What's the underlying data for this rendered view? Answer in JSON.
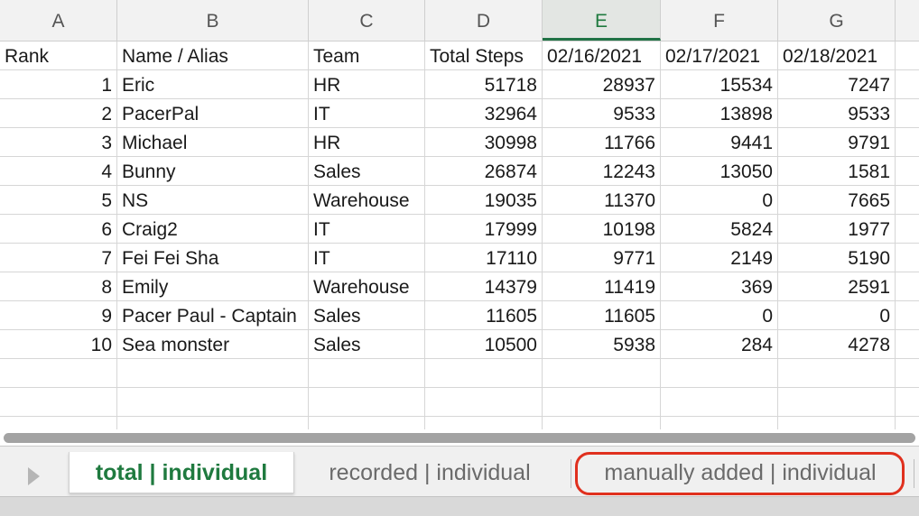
{
  "columns": [
    {
      "letter": "A",
      "selected": false
    },
    {
      "letter": "B",
      "selected": false
    },
    {
      "letter": "C",
      "selected": false
    },
    {
      "letter": "D",
      "selected": false
    },
    {
      "letter": "E",
      "selected": true
    },
    {
      "letter": "F",
      "selected": false
    },
    {
      "letter": "G",
      "selected": false
    }
  ],
  "header_row": [
    "Rank",
    "Name / Alias",
    "Team",
    "Total Steps",
    "02/16/2021",
    "02/17/2021",
    "02/18/2021"
  ],
  "rows": [
    [
      "1",
      "Eric",
      "HR",
      "51718",
      "28937",
      "15534",
      "7247"
    ],
    [
      "2",
      "PacerPal",
      "IT",
      "32964",
      "9533",
      "13898",
      "9533"
    ],
    [
      "3",
      "Michael",
      "HR",
      "30998",
      "11766",
      "9441",
      "9791"
    ],
    [
      "4",
      "Bunny",
      "Sales",
      "26874",
      "12243",
      "13050",
      "1581"
    ],
    [
      "5",
      "NS",
      "Warehouse",
      "19035",
      "11370",
      "0",
      "7665"
    ],
    [
      "6",
      "Craig2",
      "IT",
      "17999",
      "10198",
      "5824",
      "1977"
    ],
    [
      "7",
      "Fei Fei  Sha",
      "IT",
      "17110",
      "9771",
      "2149",
      "5190"
    ],
    [
      "8",
      "Emily",
      "Warehouse",
      "14379",
      "11419",
      "369",
      "2591"
    ],
    [
      "9",
      "Pacer Paul - Captain",
      "Sales",
      "11605",
      "11605",
      "0",
      "0"
    ],
    [
      "10",
      "Sea monster",
      "Sales",
      "10500",
      "5938",
      "284",
      "4278"
    ]
  ],
  "tabs": [
    {
      "label": "total | individual",
      "active": true,
      "highlighted": false
    },
    {
      "label": "recorded | individual",
      "active": false,
      "highlighted": false
    },
    {
      "label": "manually added | individual",
      "active": false,
      "highlighted": true
    }
  ],
  "colors": {
    "accent": "#217346",
    "highlight": "#e0301e"
  }
}
